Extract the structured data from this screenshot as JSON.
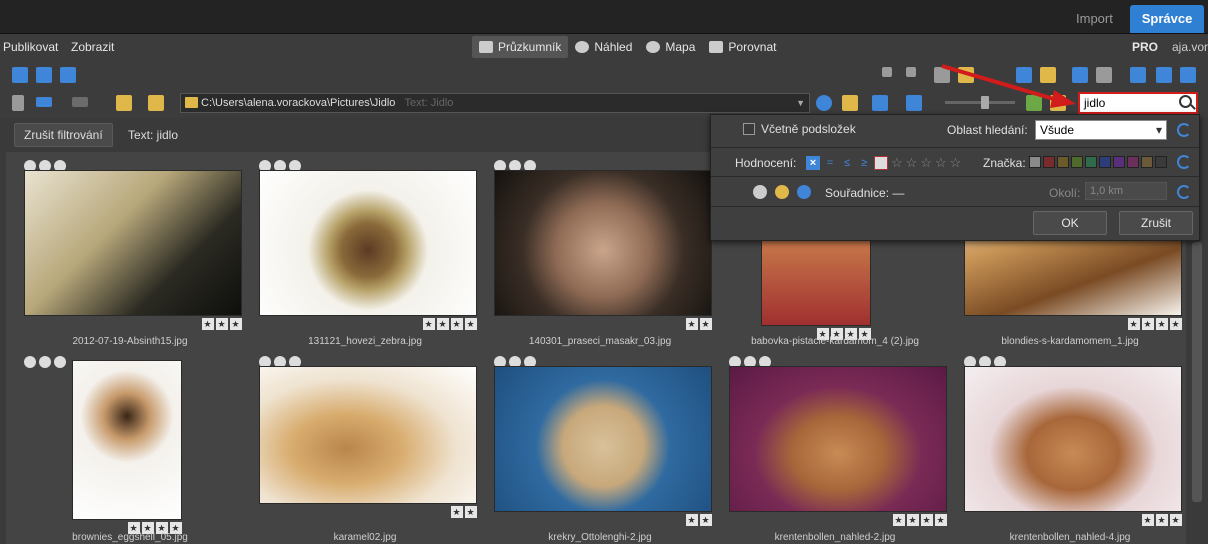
{
  "tabs": {
    "import": "Import",
    "manager": "Správce"
  },
  "menu": {
    "publish": "Publikovat",
    "view": "Zobrazit"
  },
  "modes": [
    "Průzkumník",
    "Náhled",
    "Mapa",
    "Porovnat"
  ],
  "edition": "PRO",
  "user": "aja.vor",
  "path": {
    "value": "C:\\Users\\alena.vorackova\\Pictures\\Jidlo",
    "hint": "Text: Jidlo"
  },
  "search": {
    "value": "jidlo"
  },
  "filter": {
    "clear_label": "Zrušit filtrování",
    "active_text": "Text: jidlo"
  },
  "panel": {
    "include_subfolders": "Včetně podsložek",
    "search_area_label": "Oblast hledání:",
    "search_area_value": "Všude",
    "rating_label": "Hodnocení:",
    "rating_ops": [
      "×",
      "=",
      "≤",
      "≥"
    ],
    "tag_label": "Značka:",
    "tag_colors": [
      "#8a8a8a",
      "#7a2c2c",
      "#6b5a2a",
      "#4f6a2a",
      "#2f6a4a",
      "#2c3d7a",
      "#5a2f7a",
      "#6a2f5a",
      "#6b5a3a",
      "#3a3a3a"
    ],
    "coords_label": "Souřadnice: —",
    "radius_label": "Okolí:",
    "radius_value": "1,0 km",
    "ok": "OK",
    "cancel": "Zrušit"
  },
  "photos": [
    {
      "name": "2012-07-19-Absinth15.jpg",
      "stars": 3,
      "bg": "linear-gradient(135deg,#e9e2d0 0%,#b7a77a 40%,#2b2a22 70%,#0e0e0c 100%)"
    },
    {
      "name": "131121_hovezi_zebra.jpg",
      "stars": 4,
      "bg": "radial-gradient(circle at 50% 55%,#5b3a22 0%,#8a6a3a 20%,#b8a36a 30%,#f3f1ea 45%,#ffffff 100%)"
    },
    {
      "name": "140301_praseci_masakr_03.jpg",
      "stars": 2,
      "bg": "radial-gradient(circle at 50% 55%,#caa58c 0%,#8f6b55 35%,#3a2e26 60%,#15120f 100%)"
    },
    {
      "name": "babovka-pistacie-kardamom_4 (2).jpg",
      "stars": 4,
      "bg": "linear-gradient(180deg,#c24a3a 0%,#c8784a 45%,#a03030 100%)"
    },
    {
      "name": "blondies-s-kardamomem_1.jpg",
      "stars": 4,
      "bg": "linear-gradient(160deg,#f4efe6 0%,#c99657 40%,#7a4b24 70%,#f7f3ec 100%)"
    },
    {
      "name": "brownies_eggshell_05.jpg",
      "stars": 4,
      "bg": "radial-gradient(circle at 50% 35%,#3a2516 0%,#c79a6b 20%,#f4f1ec 40%,#ffffff 100%)"
    },
    {
      "name": "karamel02.jpg",
      "stars": 2,
      "bg": "radial-gradient(ellipse at 40% 60%,#b9854a 0%,#d8ac6e 30%,#efe3d0 60%,#ffffff 100%)"
    },
    {
      "name": "krekry_Ottolenghi-2.jpg",
      "stars": 2,
      "bg": "radial-gradient(circle at 50% 55%,#d9c19a 0%,#c7a87b 30%,#2f6aa0 50%,#1f4f7f 100%)"
    },
    {
      "name": "krentenbollen_nahled-2.jpg",
      "stars": 4,
      "bg": "radial-gradient(ellipse at 50% 60%,#c88b55 0%,#a8673a 30%,#7a2a55 55%,#5a1a45 100%)"
    },
    {
      "name": "krentenbollen_nahled-4.jpg",
      "stars": 3,
      "bg": "radial-gradient(ellipse at 50% 60%,#c88b55 0%,#a8673a 30%,#e8d6d8 55%,#f4eef0 100%)"
    }
  ]
}
